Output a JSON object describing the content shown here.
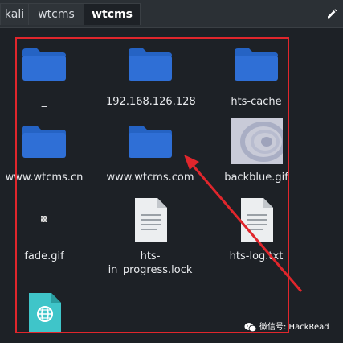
{
  "tabs": [
    {
      "label": "kali"
    },
    {
      "label": "wtcms"
    },
    {
      "label": "wtcms"
    }
  ],
  "files": [
    {
      "name": "_",
      "type": "folder"
    },
    {
      "name": "192.168.126.128",
      "type": "folder"
    },
    {
      "name": "hts-cache",
      "type": "folder"
    },
    {
      "name": "www.wtcms.cn",
      "type": "folder"
    },
    {
      "name": "www.wtcms.com",
      "type": "folder"
    },
    {
      "name": "backblue.gif",
      "type": "image"
    },
    {
      "name": "fade.gif",
      "type": "image"
    },
    {
      "name": "hts-\nin_progress.lock",
      "type": "document"
    },
    {
      "name": "hts-log.txt",
      "type": "document"
    },
    {
      "name": "",
      "type": "html"
    }
  ],
  "watermark": "微信号: HackRead",
  "colors": {
    "folder": "#2f6fd6",
    "selection": "#e0262c",
    "background": "#1d2126"
  }
}
